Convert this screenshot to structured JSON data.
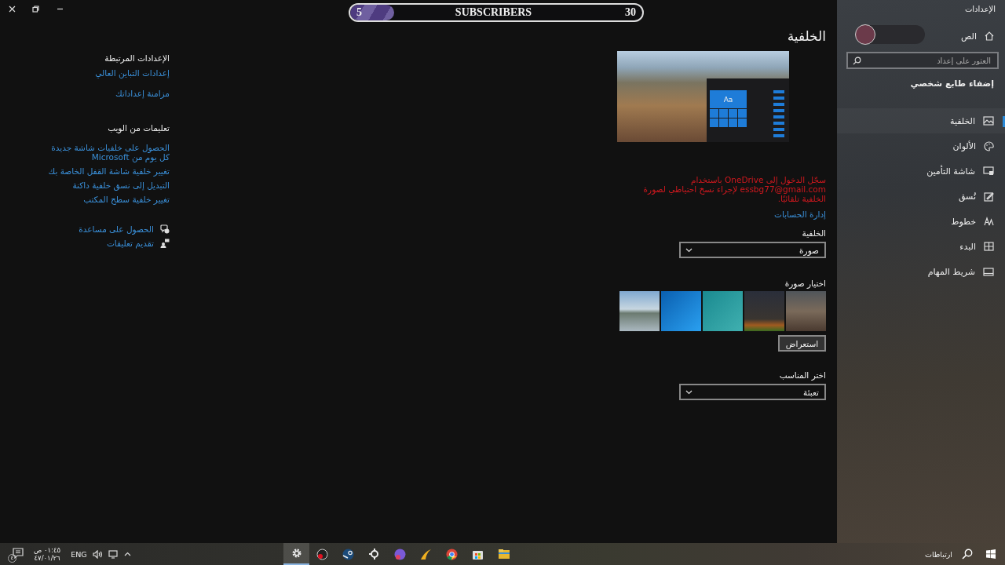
{
  "subscriber_bar": {
    "current": "5",
    "label": "SUBSCRIBERS",
    "goal": "30",
    "level": 0.15
  },
  "sidebar": {
    "title": "الإعدادات",
    "home": "الص",
    "search": {
      "placeholder": "العثور على إعداد"
    },
    "section": "إضفاء طابع شخصي",
    "items": [
      {
        "kind": "picture",
        "label": "الخلفية",
        "selected": true
      },
      {
        "kind": "palette",
        "label": "الألوان",
        "selected": false
      },
      {
        "kind": "lockscreen",
        "label": "شاشة التأمين",
        "selected": false
      },
      {
        "kind": "theme",
        "label": "نُسق",
        "selected": false
      },
      {
        "kind": "fonts",
        "label": "خطوط",
        "selected": false
      },
      {
        "kind": "start",
        "label": "البدء",
        "selected": false
      },
      {
        "kind": "taskbar",
        "label": "شريط المهام",
        "selected": false
      }
    ]
  },
  "page": {
    "title": "الخلفية",
    "preview_tile_text": "Aa",
    "sync_warning": "سجّل الدخول إلى OneDrive باستخدام essbg77@gmail.com لإجراء نسخ احتياطي لصورة الخلفية تلقائيًا.",
    "accounts_link": "إدارة الحسابات",
    "background": {
      "label": "الخلفية",
      "value": "صورة"
    },
    "choose_picture": {
      "label": "اختيار صورة",
      "browse": "استعراض"
    },
    "fit": {
      "label": "اختر المناسب",
      "value": "تعبئة"
    }
  },
  "related": {
    "heading": "الإعدادات المرتبطة",
    "links": [
      "إعدادات التباين العالي",
      "مزامنة إعداداتك"
    ],
    "web_heading": "تعليمات من الويب",
    "web_links": [
      "الحصول على خلفيات شاشة جديدة كل يوم من Microsoft",
      "تغيير خلفية شاشة القفل الخاصة بك",
      "التبديل إلى نسق خلفية داكنة",
      "تغيير خلفية سطح المكتب"
    ],
    "help": [
      {
        "kind": "help",
        "label": "الحصول على مساعدة"
      },
      {
        "kind": "feedback",
        "label": "تقديم تعليقات"
      }
    ]
  },
  "taskbar": {
    "search_label": "ارتباطات",
    "apps": [
      {
        "kind": "explorer",
        "active": false
      },
      {
        "kind": "store",
        "active": false
      },
      {
        "kind": "chrome",
        "active": false
      },
      {
        "kind": "yellow",
        "active": false
      },
      {
        "kind": "chat",
        "active": false
      },
      {
        "kind": "steelseries",
        "active": false
      },
      {
        "kind": "steam",
        "active": false
      },
      {
        "kind": "recorder",
        "active": false
      },
      {
        "kind": "settings",
        "active": true
      }
    ],
    "language": "ENG",
    "time": "٠١:٤٥ ص",
    "date": "٤٧/٠١/٢٦",
    "notification_count": "٤"
  }
}
